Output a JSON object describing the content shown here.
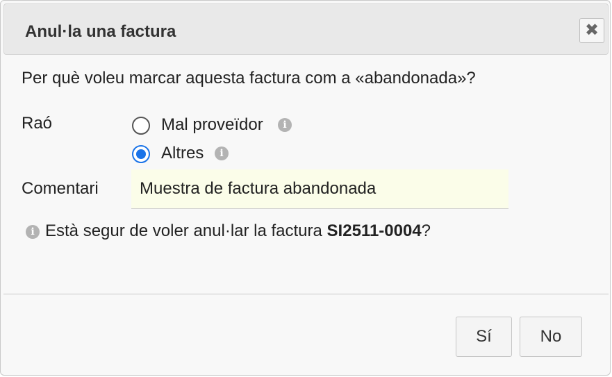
{
  "dialog": {
    "title": "Anul·la una factura",
    "close_icon": "close-icon",
    "question": "Per què voleu marcar aquesta factura com a «abandonada»?",
    "reason_label": "Raó",
    "options": [
      {
        "label": "Mal proveïdor",
        "checked": false
      },
      {
        "label": "Altres",
        "checked": true
      }
    ],
    "comment_label": "Comentari",
    "comment_value": "Muestra de factura abandonada",
    "confirm_prefix": "Està segur de voler anul·lar la factura ",
    "invoice_ref": "SI2511-0004",
    "confirm_suffix": "?",
    "buttons": {
      "yes": "Sí",
      "no": "No"
    },
    "accent_color": "#1a73e8",
    "input_bg": "#fbfde9"
  }
}
